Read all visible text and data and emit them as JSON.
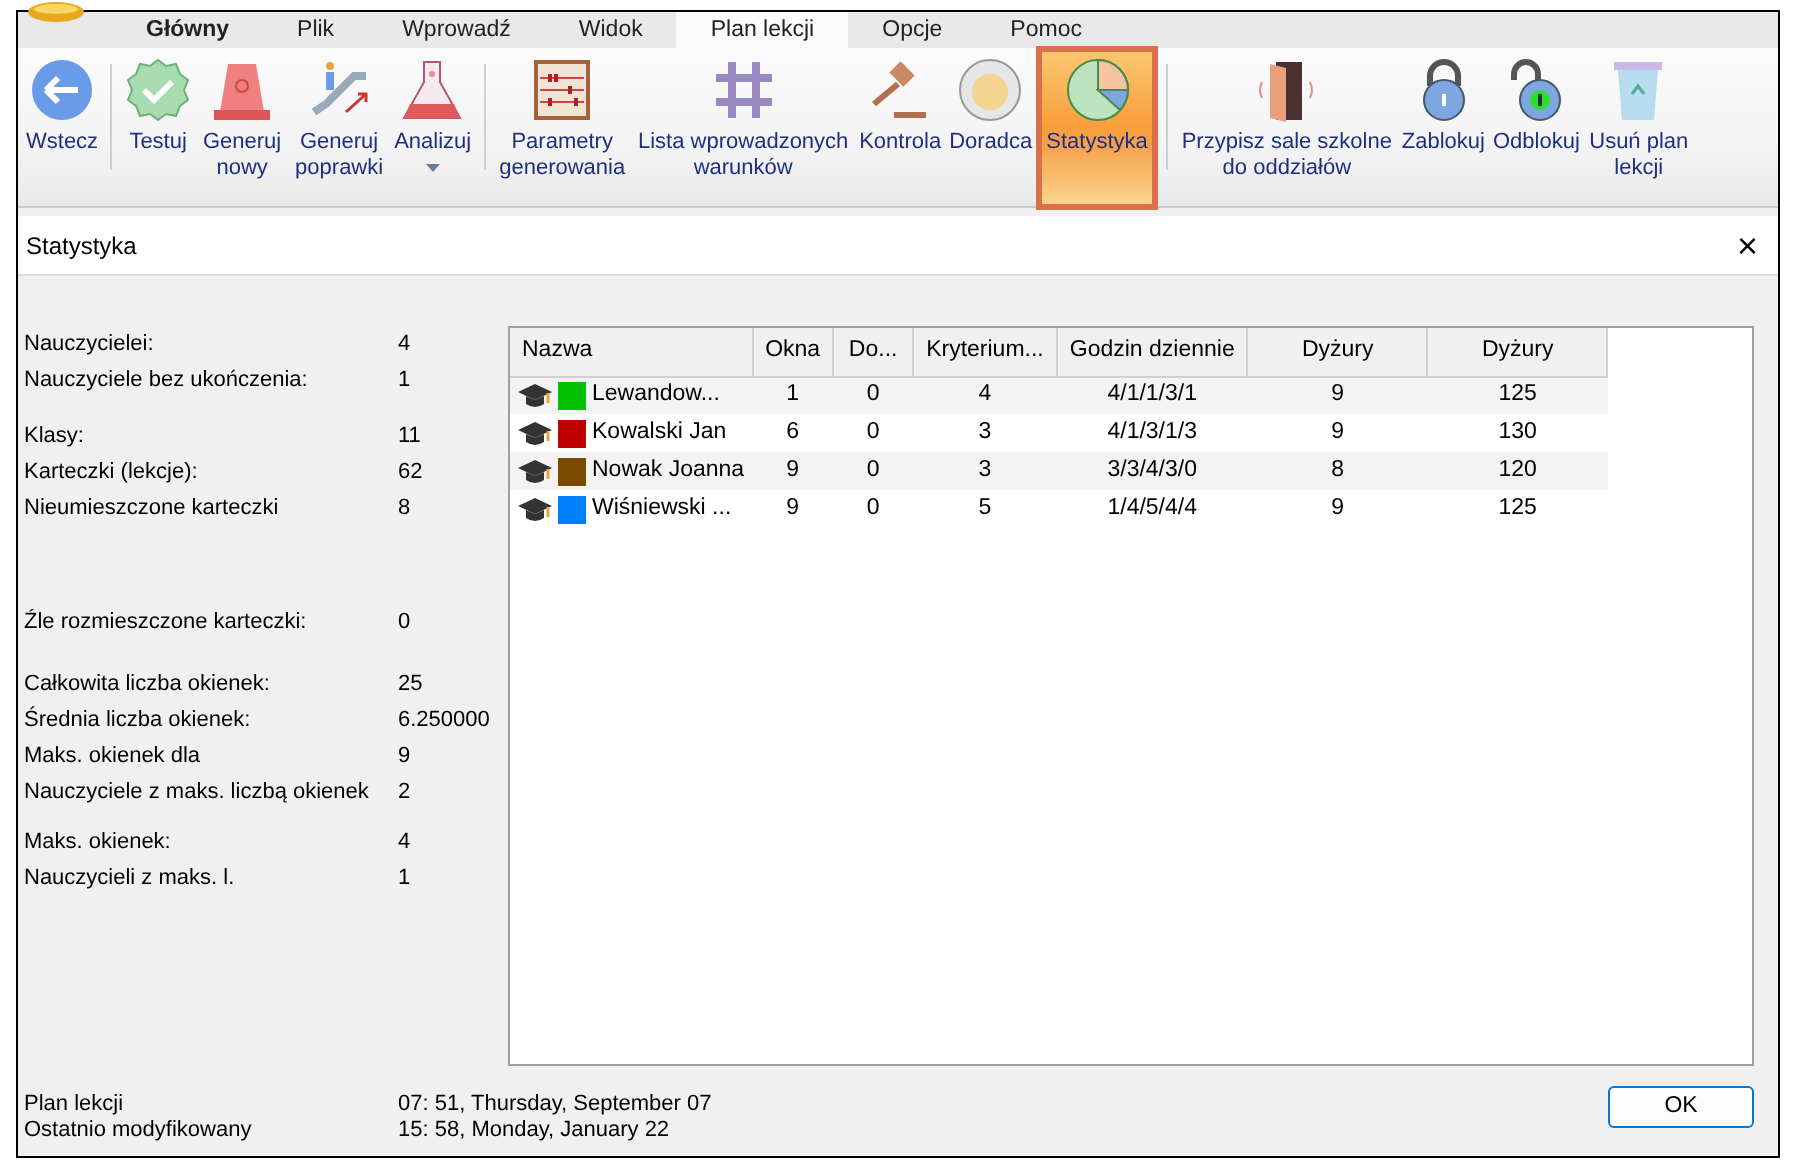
{
  "menu_tabs": [
    {
      "label": "Główny",
      "selected": false,
      "bold": true
    },
    {
      "label": "Plik",
      "selected": false,
      "bold": false
    },
    {
      "label": "Wprowadź",
      "selected": false,
      "bold": false
    },
    {
      "label": "Widok",
      "selected": false,
      "bold": false
    },
    {
      "label": "Plan lekcji",
      "selected": true,
      "bold": false
    },
    {
      "label": "Opcje",
      "selected": false,
      "bold": false
    },
    {
      "label": "Pomoc",
      "selected": false,
      "bold": false
    }
  ],
  "ribbon": [
    [
      {
        "label": "Wstecz",
        "selected": false
      }
    ],
    [
      {
        "label": "Testuj",
        "selected": false
      },
      {
        "label": "Generuj nowy",
        "selected": false
      },
      {
        "label": "Generuj poprawki",
        "selected": false
      },
      {
        "label": "Analizuj",
        "selected": false,
        "dropdown": true
      }
    ],
    [
      {
        "label": "Parametry generowania",
        "selected": false
      },
      {
        "label": "Lista wprowadzonych warunków",
        "selected": false
      },
      {
        "label": "Kontrola",
        "selected": false
      },
      {
        "label": "Doradca",
        "selected": false
      },
      {
        "label": "Statystyka",
        "selected": true
      }
    ],
    [
      {
        "label": "Przypisz sale szkolne do oddziałów",
        "selected": false
      },
      {
        "label": "Zablokuj",
        "selected": false
      },
      {
        "label": "Odblokuj",
        "selected": false
      },
      {
        "label": "Usuń plan lekcji",
        "selected": false
      }
    ]
  ],
  "dialog": {
    "title": "Statystyka",
    "close": "×"
  },
  "stats": [
    [
      {
        "label": "Nauczycielei:",
        "value": "4"
      },
      {
        "label": "Nauczyciele bez ukończenia:",
        "value": "1"
      }
    ],
    [
      {
        "label": "Klasy:",
        "value": "11"
      },
      {
        "label": "Karteczki (lekcje):",
        "value": "62"
      },
      {
        "label": "Nieumieszczone karteczki",
        "value": "8"
      }
    ],
    [
      {
        "label": "Źle rozmieszczone karteczki:",
        "value": "0"
      }
    ],
    [
      {
        "label": "Całkowita liczba okienek:",
        "value": "25"
      },
      {
        "label": "Średnia liczba okienek:",
        "value": "6.250000"
      },
      {
        "label": "Maks. okienek dla",
        "value": "9"
      },
      {
        "label": "Nauczyciele z maks. liczbą okienek",
        "value": "2"
      }
    ],
    [
      {
        "label": "Maks. okienek:",
        "value": "4"
      },
      {
        "label": "Nauczycieli z maks. l.",
        "value": "1"
      }
    ]
  ],
  "table": {
    "columns": [
      "Nazwa",
      "Okna",
      "Do...",
      "Kryterium...",
      "Godzin dziennie",
      "Dyżury",
      "Dyżury"
    ],
    "rows": [
      {
        "color": "#00c000",
        "cells": [
          "Lewandow...",
          "1",
          "0",
          "4",
          "4/1/1/3/1",
          "9",
          "125"
        ]
      },
      {
        "color": "#c00000",
        "cells": [
          "Kowalski Jan",
          "6",
          "0",
          "3",
          "4/1/3/1/3",
          "9",
          "130"
        ]
      },
      {
        "color": "#7a4a00",
        "cells": [
          "Nowak Joanna",
          "9",
          "0",
          "3",
          "3/3/4/3/0",
          "8",
          "120"
        ]
      },
      {
        "color": "#0080ff",
        "cells": [
          "Wiśniewski ...",
          "9",
          "0",
          "5",
          "1/4/5/4/4",
          "9",
          "125"
        ]
      }
    ]
  },
  "footer": [
    {
      "label": "Plan lekcji",
      "value": "07: 51, Thursday, September 07"
    },
    {
      "label": "Ostatnio modyfikowany",
      "value": "15: 58, Monday, January 22"
    }
  ],
  "ok_button": "OK"
}
